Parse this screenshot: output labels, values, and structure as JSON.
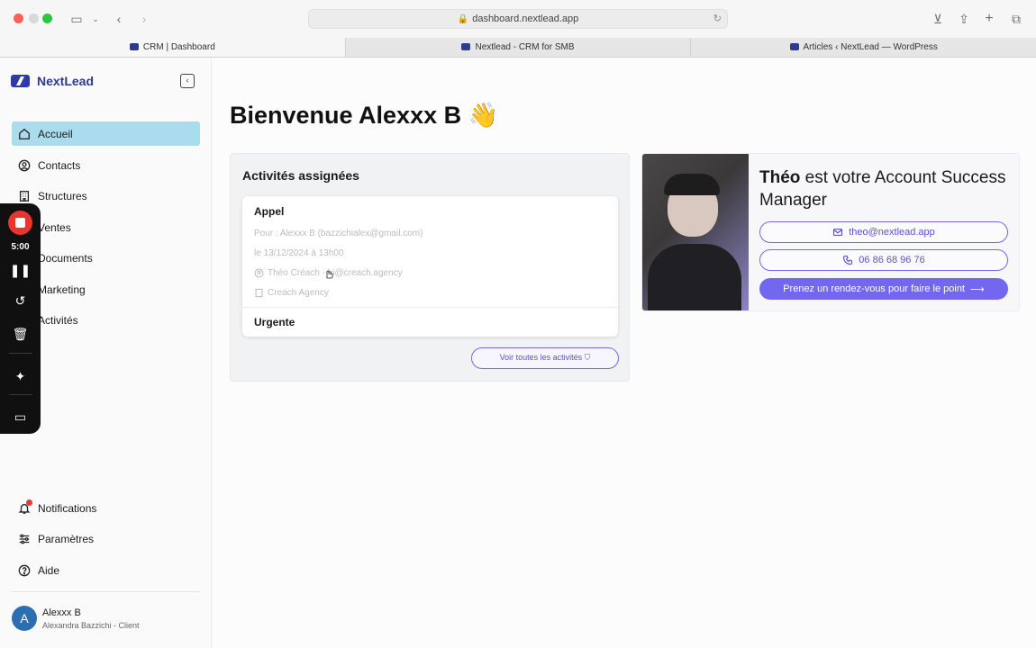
{
  "browser": {
    "url": "dashboard.nextlead.app",
    "tabs": [
      {
        "label": "CRM | Dashboard"
      },
      {
        "label": "Nextlead - CRM for SMB"
      },
      {
        "label": "Articles ‹ NextLead — WordPress"
      }
    ]
  },
  "sidebar": {
    "brand": "NextLead",
    "nav": [
      {
        "label": "Accueil",
        "icon": "home-icon",
        "active": true
      },
      {
        "label": "Contacts",
        "icon": "user-circle-icon"
      },
      {
        "label": "Structures",
        "icon": "building-icon"
      },
      {
        "label": "Ventes",
        "icon": "dollar-icon"
      },
      {
        "label": "Documents",
        "icon": "document-icon"
      },
      {
        "label": "Marketing",
        "icon": "megaphone-icon"
      },
      {
        "label": "Activités",
        "icon": "calendar-icon"
      }
    ],
    "bottom": [
      {
        "label": "Notifications",
        "icon": "bell-icon"
      },
      {
        "label": "Paramètres",
        "icon": "sliders-icon"
      },
      {
        "label": "Aide",
        "icon": "help-icon"
      }
    ],
    "user": {
      "initial": "A",
      "name": "Alexxx B",
      "subtitle": "Alexandra Bazzichi - Client"
    }
  },
  "recorder": {
    "time": "5:00"
  },
  "main": {
    "title": "Bienvenue Alexxx B 👋",
    "activities": {
      "title": "Activités assignées",
      "item": {
        "type": "Appel",
        "for": "Pour : Alexxx B (bazzichialex@gmail.com)",
        "date": "le 13/12/2024 à 13h00",
        "contact": "Théo Créach - hi@creach.agency",
        "company": "Creach Agency"
      },
      "priority": "Urgente",
      "all_button": "Voir toutes les activités"
    },
    "manager": {
      "name": "Théo",
      "title_rest": " est votre Account Success Manager",
      "email": "theo@nextlead.app",
      "phone": "06 86 68 96 76",
      "cta": "Prenez un rendez-vous pour faire le point"
    }
  },
  "colors": {
    "accent": "#7367f0",
    "active_nav": "#abdcee",
    "brand": "#2e3a8c"
  }
}
